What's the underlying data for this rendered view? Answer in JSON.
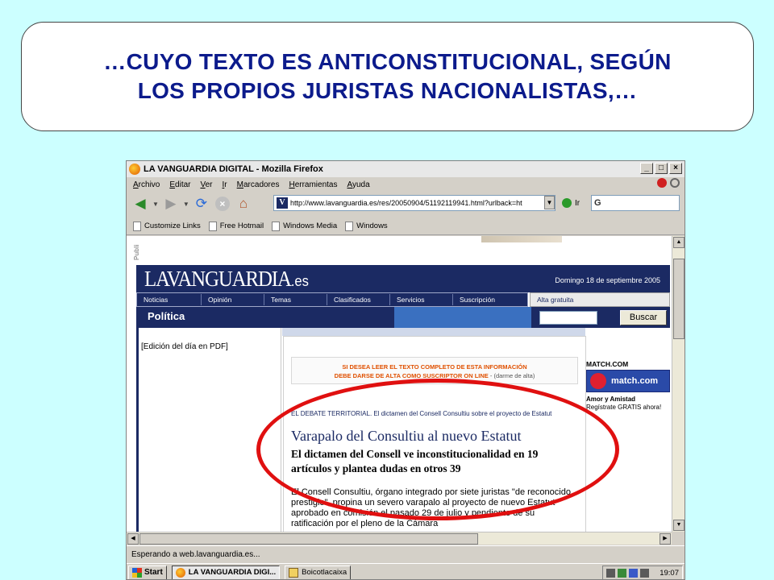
{
  "banner": {
    "line1": "…CUYO TEXTO ES ANTICONSTITUCIONAL, SEGÚN",
    "line2": "LOS PROPIOS JURISTAS NACIONALISTAS,…"
  },
  "browser": {
    "title": "LA VANGUARDIA DIGITAL - Mozilla Firefox",
    "menu": [
      "Archivo",
      "Editar",
      "Ver",
      "Ir",
      "Marcadores",
      "Herramientas",
      "Ayuda"
    ],
    "url": "http://www.lavanguardia.es/res/20050904/51192119941.html?urlback=ht",
    "go_label": "Ir",
    "search_text": "G",
    "bookmarks": [
      "Customize Links",
      "Free Hotmail",
      "Windows Media",
      "Windows"
    ],
    "status": "Esperando a web.lavanguardia.es..."
  },
  "page": {
    "publi": "Publi",
    "logo_main": "LAVANGUARDIA",
    "logo_suffix": ".es",
    "date": "Domingo 18 de septiembre 2005",
    "nav": [
      "Noticias",
      "Opinión",
      "Temas",
      "Clasificados",
      "Servicios",
      "Suscripción"
    ],
    "alta": "Alta gratuita",
    "section": "Política",
    "search_button": "Buscar",
    "pdf_link": "[Edición del día en PDF]",
    "notice_line1": "SI DESEA LEER EL TEXTO COMPLETO DE ESTA INFORMACIÓN",
    "notice_line2": "DEBE DARSE DE ALTA COMO SUSCRIPTOR ON LINE",
    "notice_link": " - (darme de alta)",
    "kicker": "EL DEBATE TERRITORIAL. El dictamen del Consell Consultiu sobre el proyecto de Estatut",
    "headline": "Varapalo del Consultiu al nuevo Estatut",
    "subhead": "El dictamen del Consell ve inconstitucionalidad en 19 artículos y plantea dudas en otros 39",
    "body": "El Consell Consultiu, órgano integrado por siete juristas \"de reconocido prestigio\", propina un severo varapalo al proyecto de nuevo Estatut aprobado en comisión el pasado 29 de julio y pendiente de su ratificación por el pleno de la Cámara",
    "ad": {
      "title": "MATCH.COM",
      "banner": "match.com",
      "line1": "Amor y Amistad",
      "line2": "Regístrate GRATIS ahora!"
    }
  },
  "taskbar": {
    "start": "Start",
    "tasks": [
      "LA VANGUARDIA DIGI...",
      "Boicotlacaixa"
    ],
    "clock": "19:07"
  }
}
